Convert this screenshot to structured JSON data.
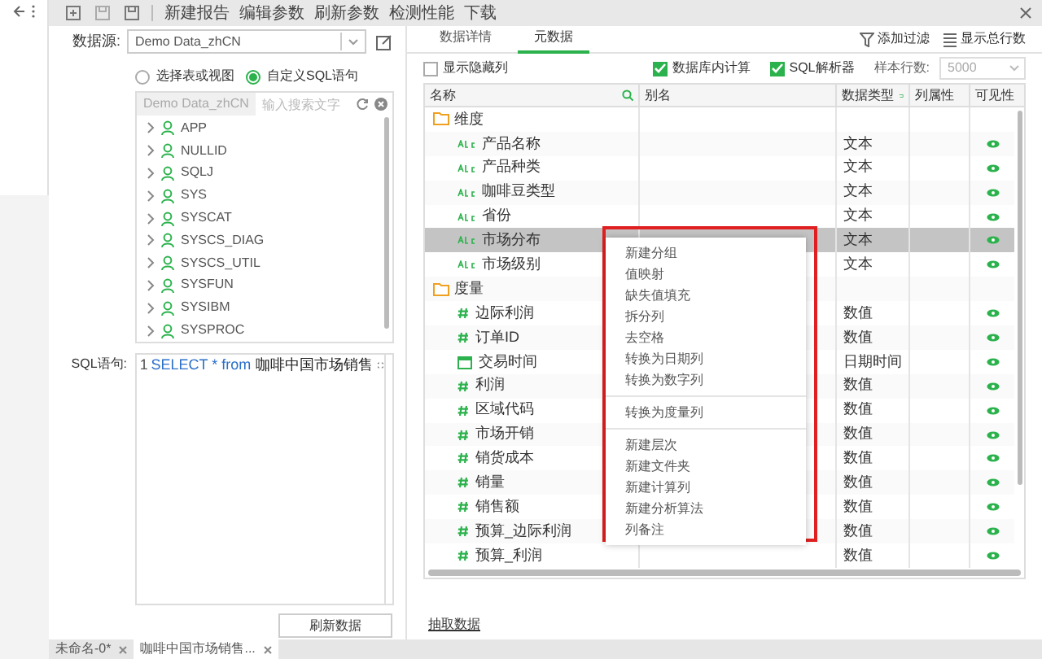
{
  "toolbar": {
    "items": [
      "新建报告",
      "编辑参数",
      "刷新参数",
      "检测性能",
      "下载"
    ]
  },
  "datasource": {
    "label": "数据源:",
    "value": "Demo Data_zhCN"
  },
  "source_mode": [
    {
      "label": "选择表或视图",
      "selected": false
    },
    {
      "label": "自定义SQL语句",
      "selected": true
    }
  ],
  "tree": {
    "source": "Demo Data_zhCN",
    "placeholder": "输入搜索文字",
    "items": [
      {
        "label": "APP"
      },
      {
        "label": "NULLID"
      },
      {
        "label": "SQLJ"
      },
      {
        "label": "SYS"
      },
      {
        "label": "SYSCAT"
      },
      {
        "label": "SYSCS_DIAG"
      },
      {
        "label": "SYSCS_UTIL"
      },
      {
        "label": "SYSFUN"
      },
      {
        "label": "SYSIBM"
      },
      {
        "label": "SYSPROC"
      }
    ]
  },
  "sql": {
    "label": "SQL语句:",
    "line_number": "1",
    "code": [
      {
        "kind": "keyword",
        "text": "SELECT * from"
      },
      {
        "kind": "identifier",
        "text": "咖啡中国市场销售"
      }
    ]
  },
  "refresh_button": "刷新数据",
  "doc_tabs": [
    {
      "label": "未命名-0*",
      "selected": false
    },
    {
      "label": "咖啡中国市场销售...",
      "selected": true
    }
  ],
  "right_tabs": [
    {
      "label": "数据详情",
      "selected": false
    },
    {
      "label": "元数据",
      "selected": true
    }
  ],
  "actions": [
    {
      "kind": "filter",
      "label": "添加过滤"
    },
    {
      "kind": "rows",
      "label": "显示总行数"
    }
  ],
  "options": {
    "show_hidden": {
      "label": "显示隐藏列",
      "checked": false
    },
    "in_db": {
      "label": "数据库内计算",
      "checked": true
    },
    "sql_parser": {
      "label": "SQL解析器",
      "checked": true
    },
    "sample_rows": {
      "label": "样本行数:",
      "value": "5000"
    }
  },
  "table": {
    "columns": [
      "名称",
      "别名",
      "数据类型",
      "列属性",
      "可见性"
    ],
    "folders": [
      {
        "name": "维度",
        "children": [
          {
            "name": "产品名称",
            "kind": "text",
            "type": "文本",
            "visible": true,
            "selected": false
          },
          {
            "name": "产品种类",
            "kind": "text",
            "type": "文本",
            "visible": true,
            "selected": false
          },
          {
            "name": "咖啡豆类型",
            "kind": "text",
            "type": "文本",
            "visible": true,
            "selected": false
          },
          {
            "name": "省份",
            "kind": "text",
            "type": "文本",
            "visible": true,
            "selected": false
          },
          {
            "name": "市场分布",
            "kind": "text",
            "type": "文本",
            "visible": true,
            "selected": true
          },
          {
            "name": "市场级别",
            "kind": "text",
            "type": "文本",
            "visible": true,
            "selected": false
          }
        ]
      },
      {
        "name": "度量",
        "children": [
          {
            "name": "边际利润",
            "kind": "number",
            "type": "数值",
            "visible": true,
            "selected": false
          },
          {
            "name": "订单ID",
            "kind": "number",
            "type": "数值",
            "visible": true,
            "selected": false
          },
          {
            "name": "交易时间",
            "kind": "date",
            "type": "日期时间",
            "visible": true,
            "selected": false
          },
          {
            "name": "利润",
            "kind": "number",
            "type": "数值",
            "visible": true,
            "selected": false
          },
          {
            "name": "区域代码",
            "kind": "number",
            "type": "数值",
            "visible": true,
            "selected": false
          },
          {
            "name": "市场开销",
            "kind": "number",
            "type": "数值",
            "visible": true,
            "selected": false
          },
          {
            "name": "销货成本",
            "kind": "number",
            "type": "数值",
            "visible": true,
            "selected": false
          },
          {
            "name": "销量",
            "kind": "number",
            "type": "数值",
            "visible": true,
            "selected": false
          },
          {
            "name": "销售额",
            "kind": "number",
            "type": "数值",
            "visible": true,
            "selected": false
          },
          {
            "name": "预算_边际利润",
            "kind": "number",
            "type": "数值",
            "visible": true,
            "selected": false
          },
          {
            "name": "预算_利润",
            "kind": "number",
            "type": "数值",
            "visible": true,
            "selected": false
          }
        ]
      }
    ]
  },
  "context_menu": {
    "groups": [
      [
        "新建分组",
        "值映射",
        "缺失值填充",
        "拆分列",
        "去空格",
        "转换为日期列",
        "转换为数字列"
      ],
      [
        "转换为度量列"
      ],
      [
        "新建层次",
        "新建文件夹",
        "新建计算列",
        "新建分析算法",
        "列备注"
      ]
    ]
  },
  "extract_link": "抽取数据"
}
